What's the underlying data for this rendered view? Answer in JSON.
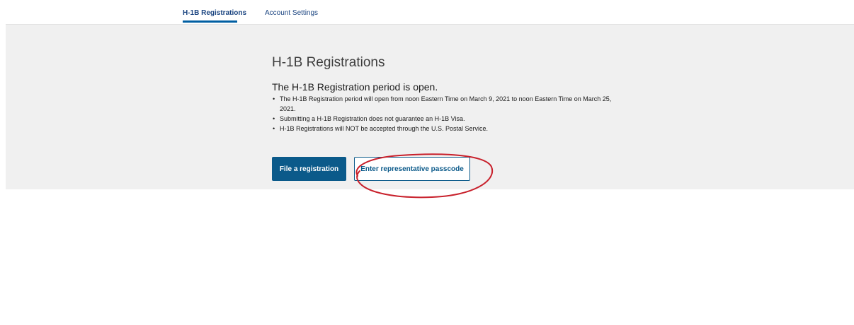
{
  "nav": {
    "tabs": [
      {
        "label": "H-1B Registrations",
        "active": true
      },
      {
        "label": "Account Settings",
        "active": false
      }
    ]
  },
  "main": {
    "title": "H-1B Registrations",
    "status": "The H-1B Registration period is open.",
    "bullets": [
      "The H-1B Registration period will open from noon Eastern Time on March 9, 2021 to noon Eastern Time on March 25, 2021.",
      "Submitting a H-1B Registration does not guarantee an H-1B Visa.",
      "H-1B Registrations will NOT be accepted through the U.S. Postal Service."
    ],
    "primary_button": "File a registration",
    "secondary_button": "Enter representative passcode"
  },
  "colors": {
    "primary": "#0b5a8a",
    "tab_active_underline": "#005ea2",
    "panel_background": "#f0f0f0",
    "annotation_circle": "#c8202b"
  }
}
